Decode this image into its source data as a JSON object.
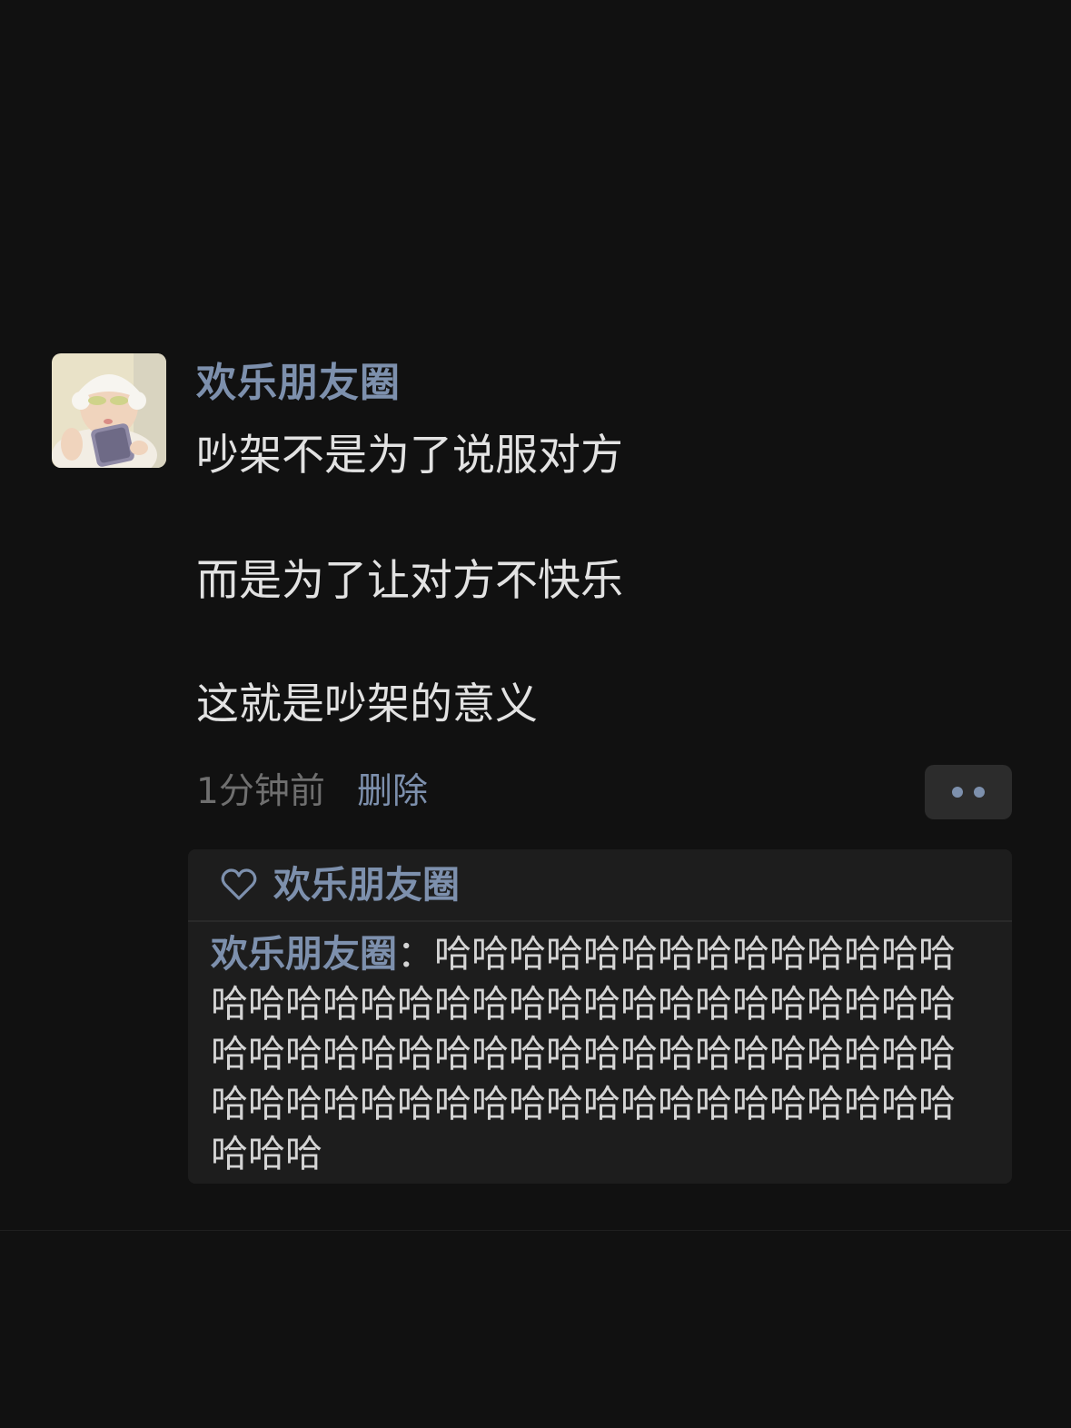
{
  "post": {
    "author": "欢乐朋友圈",
    "lines": [
      "吵架不是为了说服对方",
      "而是为了让对方不快乐",
      "这就是吵架的意义"
    ],
    "time": "1分钟前",
    "delete_label": "删除",
    "avatar_icon": "baby-avatar-photo",
    "more_icon": "two-dots-icon"
  },
  "likes": {
    "icon": "heart-outline-icon",
    "names": "欢乐朋友圈"
  },
  "comment": {
    "author": "欢乐朋友圈",
    "separator": "：",
    "text": "哈哈哈哈哈哈哈哈哈哈哈哈哈哈哈哈哈哈哈哈哈哈哈哈哈哈哈哈哈哈哈哈哈哈哈哈哈哈哈哈哈哈哈哈哈哈哈哈哈哈哈哈哈哈哈哈哈哈哈哈哈哈哈哈哈哈哈哈哈哈哈哈哈哈哈哈哈"
  },
  "colors": {
    "background": "#111111",
    "link_blue": "#7d90ad",
    "body_text": "#e2e2e2",
    "muted_text": "#6f6f6f",
    "panel": "#1d1d1d"
  }
}
